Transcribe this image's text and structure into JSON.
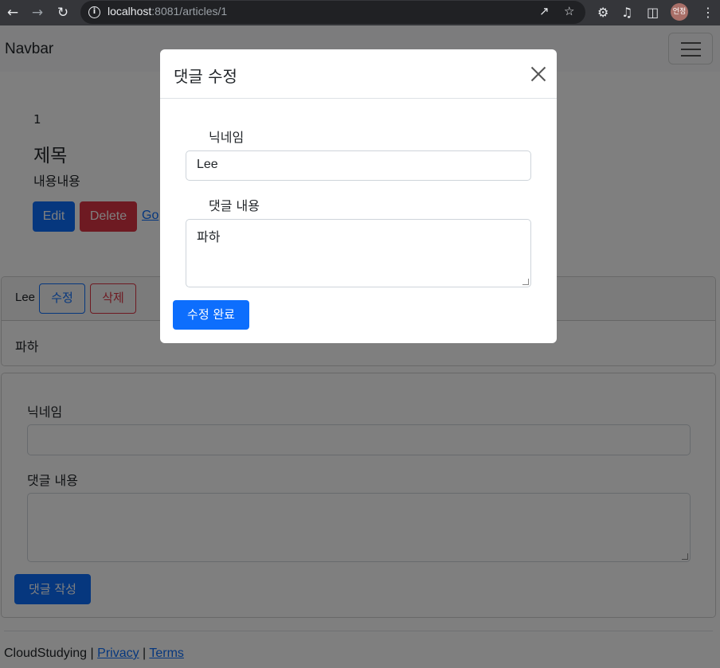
{
  "browser": {
    "url_host": "localhost",
    "url_path": ":8081/articles/1",
    "avatar_text": "언정"
  },
  "navbar": {
    "brand": "Navbar"
  },
  "article": {
    "id": "1",
    "title": "제목",
    "content": "내용내용",
    "edit_label": "Edit",
    "delete_label": "Delete",
    "go_label": "Go"
  },
  "comment": {
    "nickname": "Lee",
    "edit_label": "수정",
    "delete_label": "삭제",
    "body": "파하"
  },
  "new_comment_form": {
    "nickname_label": "닉네임",
    "body_label": "댓글 내용",
    "submit_label": "댓글 작성"
  },
  "footer": {
    "brand": "CloudStudying",
    "separator": "|",
    "privacy": "Privacy",
    "terms": "Terms"
  },
  "modal": {
    "title": "댓글 수정",
    "nickname_label": "닉네임",
    "nickname_value": "Lee",
    "body_label": "댓글 내용",
    "body_value": "파하",
    "submit_label": "수정 완료"
  },
  "colors": {
    "primary": "#0d6efd",
    "danger": "#dc3545"
  }
}
